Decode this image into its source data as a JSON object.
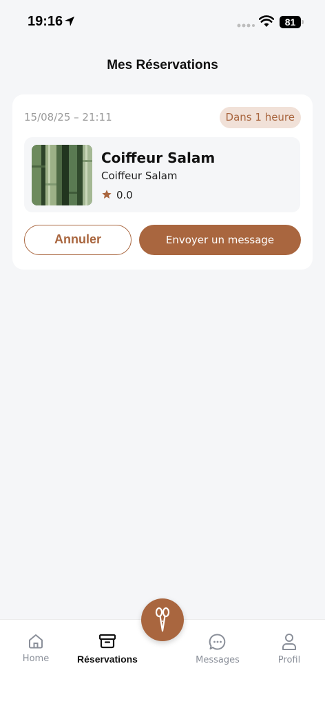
{
  "status_bar": {
    "time": "19:16",
    "battery": "81"
  },
  "page": {
    "title": "Mes Réservations"
  },
  "booking": {
    "datetime": "15/08/25 – 21:11",
    "badge": "Dans 1 heure",
    "salon_name": "Coiffeur Salam",
    "salon_subtitle": "Coiffeur Salam",
    "rating": "0.0",
    "cancel_label": "Annuler",
    "message_label": "Envoyer un message"
  },
  "nav": {
    "items": [
      {
        "label": "Home",
        "icon": "home-icon",
        "active": false
      },
      {
        "label": "Réservations",
        "icon": "reservations-box-icon",
        "active": true
      },
      {
        "label": "Messages",
        "icon": "chat-bubble-icon",
        "active": false
      },
      {
        "label": "Profil",
        "icon": "user-icon",
        "active": false
      }
    ],
    "center_action_icon": "scissors-icon"
  },
  "colors": {
    "accent": "#a9663f",
    "badge_bg": "#f1e1d8",
    "background": "#f5f6f8"
  }
}
